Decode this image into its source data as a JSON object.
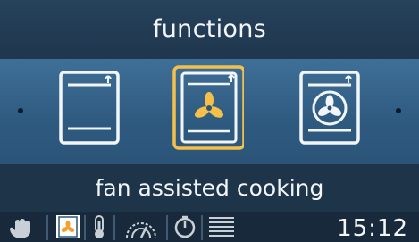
{
  "header": {
    "title": "functions"
  },
  "carousel": {
    "items": [
      {
        "icon": "conventional-oven-icon",
        "selected": false
      },
      {
        "icon": "fan-assisted-oven-icon",
        "selected": true
      },
      {
        "icon": "fan-oven-icon",
        "selected": false
      }
    ]
  },
  "selected_function": {
    "label": "fan assisted cooking"
  },
  "status_bar": {
    "icons": [
      "hand-icon",
      "fan-function-icon",
      "thermometer-icon",
      "gauge-icon",
      "timer-icon",
      "menu-lines-icon"
    ],
    "clock": "15:12"
  },
  "colors": {
    "accent": "#f5c04a",
    "icon_stroke": "#f2f6fa",
    "background": "#1d3145"
  }
}
